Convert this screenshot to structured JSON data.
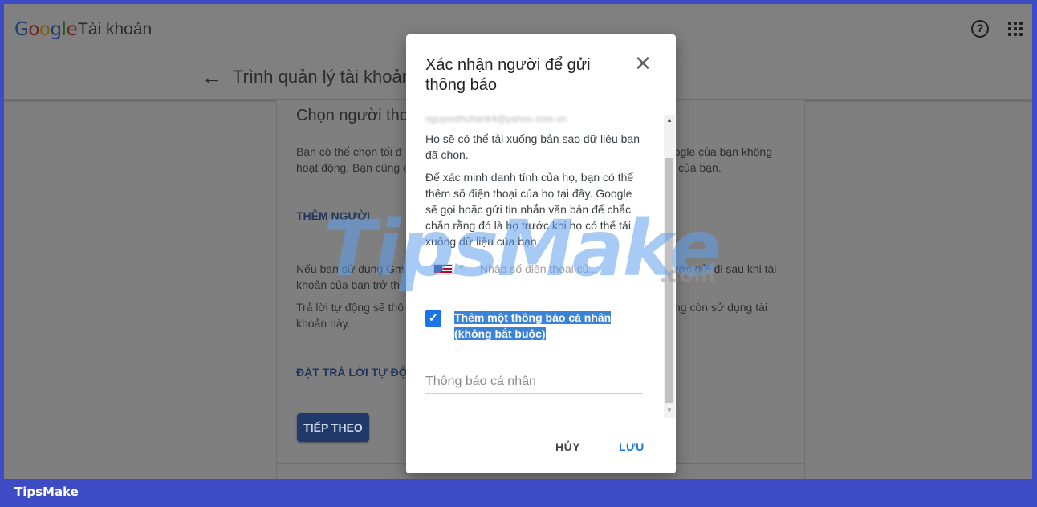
{
  "header": {
    "logo": [
      "G",
      "o",
      "o",
      "g",
      "l",
      "e"
    ],
    "account_label": "Tài khoản",
    "back_label": "←",
    "page_title": "Trình quản lý tài khoản"
  },
  "card": {
    "heading": "Chọn người tho",
    "para1_line1": "Bạn có thể chọn tối đ",
    "para1_line2": "hoạt động. Bạn cũng c",
    "para1_right1": "oogle của bạn không",
    "para1_right2": "của bạn.",
    "add_person": "THÊM NGƯỜI",
    "para2_line1": "Nếu bạn sử dụng Gm",
    "para2_line2": "khoản của bạn trở th",
    "para2_right1": "ược gửi đi sau khi tài",
    "para3_line1": "Trả lời tự động sẽ thô",
    "para3_line2": "khoản này.",
    "para3_right1": "ng còn sử dụng tài",
    "auto_reply": "ĐẶT TRẢ LỜI TỰ ĐỘ",
    "next_button": "TIẾP THEO"
  },
  "dialog": {
    "title": "Xác nhận người để gửi thông báo",
    "email": "nguyenthuhank4@yahoo.com.vn",
    "text1": "Họ sẽ có thể tải xuống bản sao dữ liệu bạn đã chọn.",
    "text2": "Để xác minh danh tính của họ, bạn có thể thêm số điện thoại của họ tại đây. Google sẽ gọi hoặc gửi tin nhắn văn bản để chắc chắn rằng đó là họ trước khi họ có thể tải xuống dữ liệu của bạn.",
    "phone_placeholder": "Nhập số điện thoại củ...",
    "checkbox_label": "Thêm một thông báo cá nhân (không bắt buộc)",
    "checkbox_checked": true,
    "message_placeholder": "Thông báo cá nhân",
    "cancel_label": "HỦY",
    "save_label": "LƯU"
  },
  "watermark": {
    "text": "TipsMake",
    "suffix": ".com"
  },
  "footer": {
    "brand": "TipsMake"
  },
  "colors": {
    "frame_border": "#3d4cc4",
    "accent": "#1a73e8",
    "overlay": "#7f7f7f"
  }
}
